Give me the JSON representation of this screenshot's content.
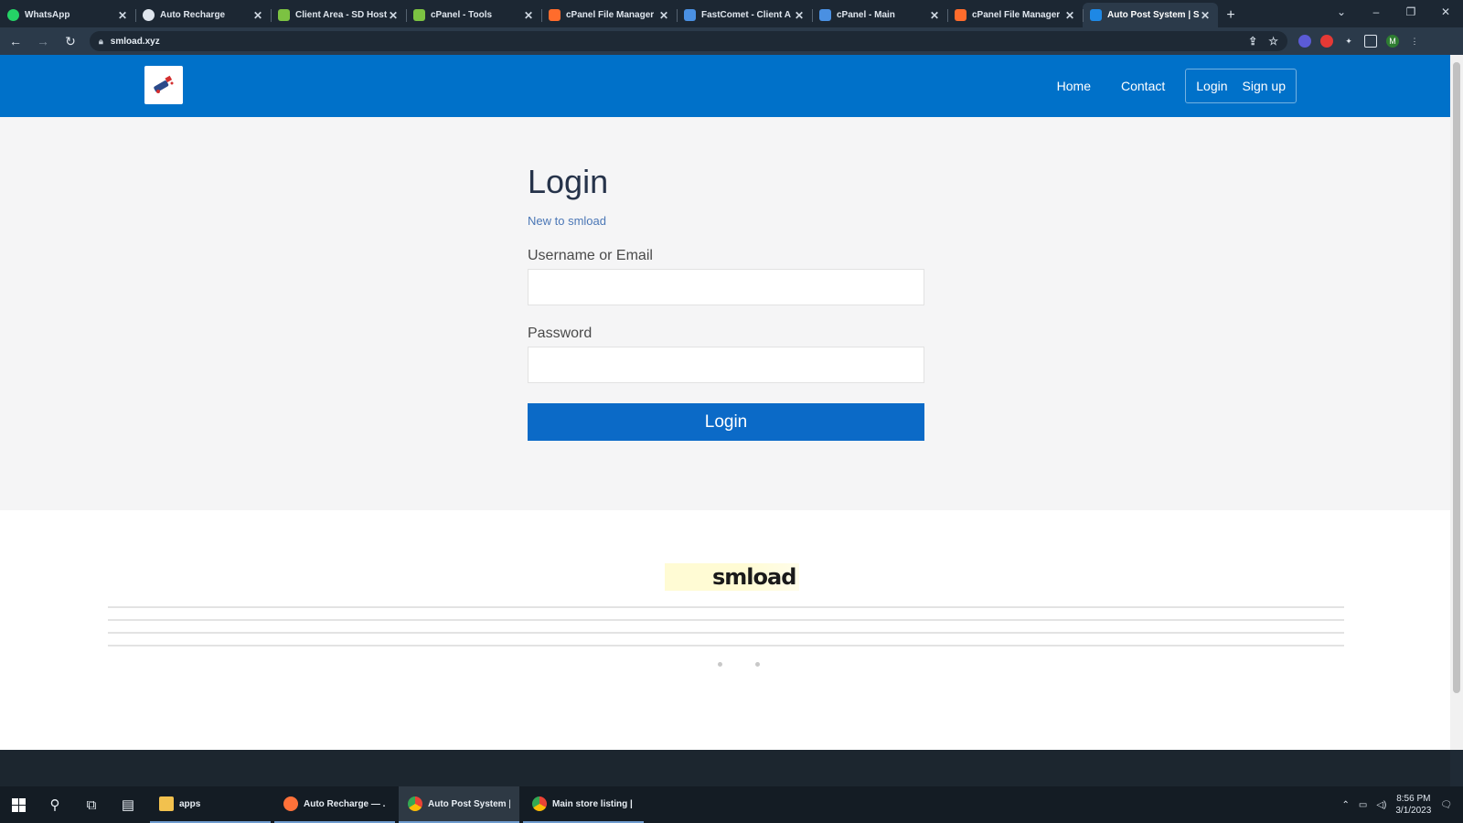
{
  "browser": {
    "tabs": [
      {
        "title": "WhatsApp",
        "favicon_color": "#25d366"
      },
      {
        "title": "Auto Recharge",
        "favicon_color": "#dfe6ee"
      },
      {
        "title": "Client Area - SD Host",
        "favicon_color": "#7cc242"
      },
      {
        "title": "cPanel - Tools",
        "favicon_color": "#7cc242"
      },
      {
        "title": "cPanel File Manager",
        "favicon_color": "#ff6c2c"
      },
      {
        "title": "FastComet - Client A",
        "favicon_color": "#4a90e2"
      },
      {
        "title": "cPanel - Main",
        "favicon_color": "#4a90e2"
      },
      {
        "title": "cPanel File Manager",
        "favicon_color": "#ff6c2c"
      },
      {
        "title": "Auto Post System | S",
        "favicon_color": "#1e88e5",
        "active": true
      }
    ],
    "url": "smload.xyz"
  },
  "site": {
    "nav": {
      "home": "Home",
      "contact": "Contact",
      "login": "Login",
      "signup": "Sign up"
    },
    "login": {
      "title": "Login",
      "new_link": "New to smload",
      "username_label": "Username or Email",
      "password_label": "Password",
      "button": "Login"
    },
    "footer": {
      "brand": "smload"
    }
  },
  "taskbar": {
    "apps": [
      {
        "label": "apps",
        "icon_color": "#f2c14e"
      },
      {
        "label": "Auto Recharge — ...",
        "icon_color": "#ff7139"
      },
      {
        "label": "Auto Post System | ...",
        "icon_color": "#4285f4",
        "active": true
      },
      {
        "label": "Main store listing | ...",
        "icon_color": "#4285f4"
      }
    ],
    "time": "8:56 PM",
    "date": "3/1/2023"
  },
  "colors": {
    "brand_blue": "#0071c9",
    "button_blue": "#0b6ac7",
    "hero_bg": "#f5f5f6"
  }
}
